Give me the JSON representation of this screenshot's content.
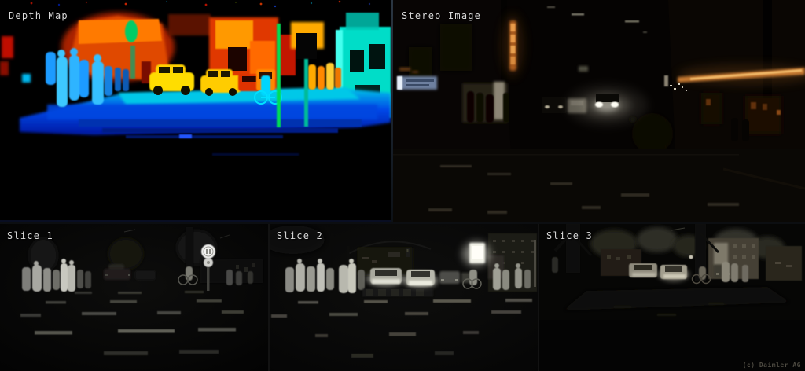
{
  "panels": {
    "depth_map": {
      "label": "Depth Map"
    },
    "stereo_image": {
      "label": "Stereo Image"
    },
    "slice_1": {
      "label": "Slice 1"
    },
    "slice_2": {
      "label": "Slice 2"
    },
    "slice_3": {
      "label": "Slice 3"
    }
  },
  "footer": {
    "copyright": "(c) Daimler AG"
  },
  "colors": {
    "background": "#000000",
    "label_text": "#d9d9d9",
    "copyright_text": "#4e4b42",
    "panel_divider_top": "#2b3642",
    "panel_divider_slices": "#121212",
    "depth_colormap_near_to_far": [
      "#aa0000",
      "#ff3300",
      "#ff8800",
      "#ffdd00",
      "#00e0cc",
      "#00c0e8",
      "#0048e8",
      "#0018a0"
    ],
    "neon_orange": "#d08438",
    "headlight_white": "#fffdf0",
    "slice_grayscale_bright": "#e8e8e8"
  }
}
